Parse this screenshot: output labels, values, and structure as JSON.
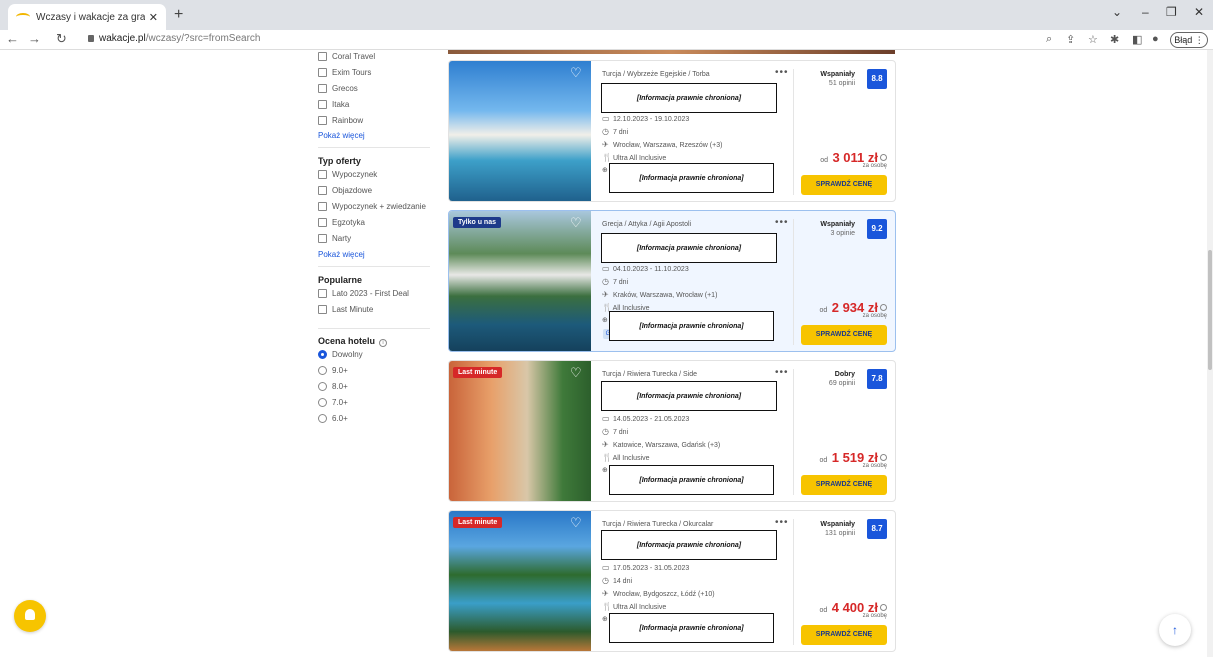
{
  "browser": {
    "tab_title": "Wczasy i wakacje za granicą na W",
    "url_domain": "wakacje.pl",
    "url_path": "/wczasy/?src=fromSearch",
    "error_label": "Błąd"
  },
  "sidebar": {
    "operators": [
      "Coral Travel",
      "Exim Tours",
      "Grecos",
      "Itaka",
      "Rainbow"
    ],
    "show_more": "Pokaż więcej",
    "offer_type_title": "Typ oferty",
    "offer_types": [
      "Wypoczynek",
      "Objazdowe",
      "Wypoczynek + zwiedzanie",
      "Egzotyka",
      "Narty"
    ],
    "popular_title": "Popularne",
    "popular": [
      "Lato 2023 - First Deal",
      "Last Minute"
    ],
    "rating_title": "Ocena hotelu",
    "ratings": [
      "Dowolny",
      "9.0+",
      "8.0+",
      "7.0+",
      "6.0+"
    ]
  },
  "offers": [
    {
      "location": "Turcja / Wybrzeże Egejskie / Torba",
      "redacted": "[Informacja prawnie chroniona]",
      "dates": "12.10.2023 - 19.10.2023",
      "duration": "7 dni",
      "departures": "Wrocław, Warszawa, Rzeszów (+3)",
      "board": "Ultra All Inclusive",
      "rating_word": "Wspaniały",
      "reviews": "51 opinii",
      "score": "8.8",
      "price_prefix": "od",
      "price": "3 011 zł",
      "per_person": "za osobę",
      "cta": "SPRAWDŹ CENĘ"
    },
    {
      "ribbon": "Tylko u nas",
      "location": "Grecja / Attyka / Agii Apostoli",
      "redacted": "[Informacja prawnie chroniona]",
      "dates": "04.10.2023 - 11.10.2023",
      "duration": "7 dni",
      "departures": "Kraków, Warszawa, Wrocław (+1)",
      "board": "All Inclusive",
      "rating_word": "Wspaniały",
      "reviews": "3 opinie",
      "score": "9.2",
      "price_prefix": "od",
      "price": "2 934 zł",
      "per_person": "za osobę",
      "cta": "SPRAWDŹ CENĘ"
    },
    {
      "ribbon": "Last minute",
      "location": "Turcja / Riwiera Turecka / Side",
      "redacted": "[Informacja prawnie chroniona]",
      "dates": "14.05.2023 - 21.05.2023",
      "duration": "7 dni",
      "departures": "Katowice, Warszawa, Gdańsk (+3)",
      "board": "All Inclusive",
      "rating_word": "Dobry",
      "reviews": "69 opinii",
      "score": "7.8",
      "price_prefix": "od",
      "price": "1 519 zł",
      "per_person": "za osobę",
      "cta": "SPRAWDŹ CENĘ"
    },
    {
      "ribbon": "Last minute",
      "location": "Turcja / Riwiera Turecka / Okurcalar",
      "redacted": "[Informacja prawnie chroniona]",
      "dates": "17.05.2023 - 31.05.2023",
      "duration": "14 dni",
      "departures": "Wrocław, Bydgoszcz, Łódź (+10)",
      "board": "Ultra All Inclusive",
      "rating_word": "Wspaniały",
      "reviews": "131 opinii",
      "score": "8.7",
      "price_prefix": "od",
      "price": "4 400 zł",
      "per_person": "za osobę",
      "cta": "SPRAWDŹ CENĘ"
    }
  ],
  "colors": {
    "accent": "#1a56db",
    "price": "#d62828",
    "cta": "#f7c400"
  }
}
